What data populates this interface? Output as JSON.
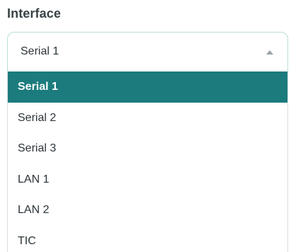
{
  "interface_field": {
    "label": "Interface",
    "selected_value": "Serial 1",
    "dropdown_open": true,
    "options": [
      {
        "label": "Serial 1",
        "selected": true
      },
      {
        "label": "Serial 2",
        "selected": false
      },
      {
        "label": "Serial 3",
        "selected": false
      },
      {
        "label": "LAN 1",
        "selected": false
      },
      {
        "label": "LAN 2",
        "selected": false
      },
      {
        "label": "TIC",
        "selected": false
      }
    ]
  },
  "icons": {
    "caret": "caret-up-icon"
  },
  "colors": {
    "selected_background": "#1b7b7d",
    "selected_text": "#ffffff",
    "text": "#2b3438",
    "select_border": "#b9ded8"
  }
}
